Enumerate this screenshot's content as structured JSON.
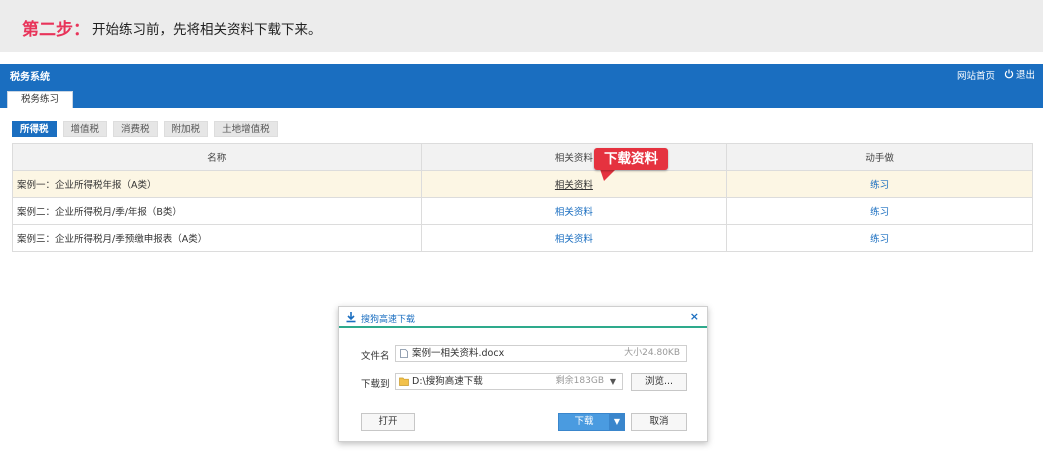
{
  "step": {
    "label": "第二步：",
    "text": "开始练习前，先将相关资料下载下来。"
  },
  "app": {
    "title": "税务系统",
    "home_link": "网站首页",
    "logout_label": "退出",
    "subnav_tab": "税务练习"
  },
  "tax_tabs": [
    "所得税",
    "增值税",
    "消费税",
    "附加税",
    "土地增值税"
  ],
  "table": {
    "headers": [
      "名称",
      "相关资料",
      "动手做"
    ],
    "rows": [
      {
        "name": "案例一：企业所得税年报（A类）",
        "material": "相关资料",
        "practice": "练习"
      },
      {
        "name": "案例二：企业所得税月/季/年报（B类）",
        "material": "相关资料",
        "practice": "练习"
      },
      {
        "name": "案例三：企业所得税月/季预缴申报表（A类）",
        "material": "相关资料",
        "practice": "练习"
      }
    ]
  },
  "callout": "下载资料",
  "dialog": {
    "title": "搜狗高速下载",
    "close": "×",
    "filename_label": "文件名",
    "filename": "案例一相关资料.docx",
    "filesize": "大小24.80KB",
    "saveto_label": "下载到",
    "path": "D:\\搜狗高速下载",
    "free_space": "剩余183GB",
    "browse": "浏览...",
    "open": "打开",
    "download": "下载",
    "cancel": "取消"
  },
  "colors": {
    "accent": "#1a6ec0",
    "step_label": "#e8345a",
    "callout": "#e5323f",
    "dialog_rule": "#2eaa8c"
  }
}
